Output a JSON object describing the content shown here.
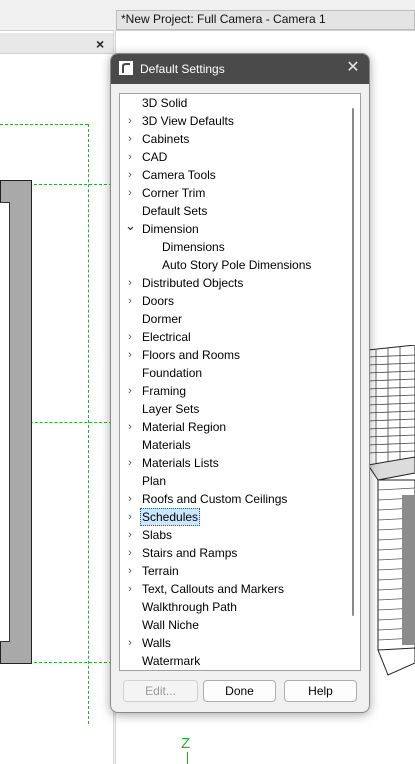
{
  "background": {
    "window_title": "*New Project: Full Camera - Camera 1",
    "left_panel_close": "×",
    "axis_label": "Z"
  },
  "dialog": {
    "title": "Default Settings",
    "close_label": "✕",
    "tree": [
      {
        "label": "3D Solid",
        "level": 0,
        "expander": "none"
      },
      {
        "label": "3D View Defaults",
        "level": 0,
        "expander": "collapsed"
      },
      {
        "label": "Cabinets",
        "level": 0,
        "expander": "collapsed"
      },
      {
        "label": "CAD",
        "level": 0,
        "expander": "collapsed"
      },
      {
        "label": "Camera Tools",
        "level": 0,
        "expander": "collapsed"
      },
      {
        "label": "Corner Trim",
        "level": 0,
        "expander": "collapsed"
      },
      {
        "label": "Default Sets",
        "level": 0,
        "expander": "none"
      },
      {
        "label": "Dimension",
        "level": 0,
        "expander": "expanded"
      },
      {
        "label": "Dimensions",
        "level": 1,
        "expander": "none"
      },
      {
        "label": "Auto Story Pole Dimensions",
        "level": 1,
        "expander": "none"
      },
      {
        "label": "Distributed Objects",
        "level": 0,
        "expander": "collapsed"
      },
      {
        "label": "Doors",
        "level": 0,
        "expander": "collapsed"
      },
      {
        "label": "Dormer",
        "level": 0,
        "expander": "none"
      },
      {
        "label": "Electrical",
        "level": 0,
        "expander": "collapsed"
      },
      {
        "label": "Floors and Rooms",
        "level": 0,
        "expander": "collapsed"
      },
      {
        "label": "Foundation",
        "level": 0,
        "expander": "none"
      },
      {
        "label": "Framing",
        "level": 0,
        "expander": "collapsed"
      },
      {
        "label": "Layer Sets",
        "level": 0,
        "expander": "none"
      },
      {
        "label": "Material Region",
        "level": 0,
        "expander": "collapsed"
      },
      {
        "label": "Materials",
        "level": 0,
        "expander": "none"
      },
      {
        "label": "Materials Lists",
        "level": 0,
        "expander": "collapsed"
      },
      {
        "label": "Plan",
        "level": 0,
        "expander": "none"
      },
      {
        "label": "Roofs and Custom Ceilings",
        "level": 0,
        "expander": "collapsed"
      },
      {
        "label": "Schedules",
        "level": 0,
        "expander": "collapsed",
        "selected": true
      },
      {
        "label": "Slabs",
        "level": 0,
        "expander": "collapsed"
      },
      {
        "label": "Stairs and Ramps",
        "level": 0,
        "expander": "collapsed"
      },
      {
        "label": "Terrain",
        "level": 0,
        "expander": "collapsed"
      },
      {
        "label": "Text, Callouts and Markers",
        "level": 0,
        "expander": "collapsed"
      },
      {
        "label": "Walkthrough Path",
        "level": 0,
        "expander": "none"
      },
      {
        "label": "Wall Niche",
        "level": 0,
        "expander": "none"
      },
      {
        "label": "Walls",
        "level": 0,
        "expander": "collapsed"
      },
      {
        "label": "Watermark",
        "level": 0,
        "expander": "none"
      }
    ],
    "buttons": {
      "edit": "Edit...",
      "done": "Done",
      "help": "Help"
    }
  }
}
